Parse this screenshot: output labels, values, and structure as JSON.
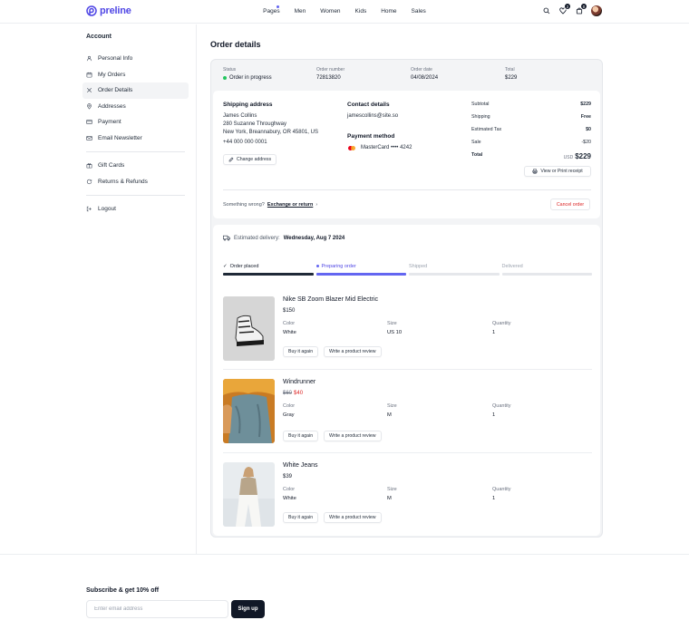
{
  "brand": {
    "name": "preline",
    "accent": "#4f46e5"
  },
  "nav": [
    "Pages",
    "Men",
    "Women",
    "Kids",
    "Home",
    "Sales"
  ],
  "header": {
    "wishlist_count": "2",
    "cart_count": "0"
  },
  "sidebar": {
    "title": "Account",
    "items": [
      {
        "label": "Personal Info",
        "icon": "user-icon"
      },
      {
        "label": "My Orders",
        "icon": "calendar-icon"
      },
      {
        "label": "Order Details",
        "icon": "order-icon"
      },
      {
        "label": "Addresses",
        "icon": "map-pin-icon"
      },
      {
        "label": "Payment",
        "icon": "credit-card-icon"
      },
      {
        "label": "Email Newsletter",
        "icon": "mail-icon"
      },
      {
        "label": "Gift Cards",
        "icon": "gift-icon"
      },
      {
        "label": "Returns & Refunds",
        "icon": "refresh-icon"
      },
      {
        "label": "Logout",
        "icon": "logout-icon"
      }
    ]
  },
  "page_title": "Order details",
  "summary": {
    "status_label": "Status",
    "status_value": "Order in progress",
    "number_label": "Order number",
    "number_value": "72813820",
    "date_label": "Order date",
    "date_value": "04/08/2024",
    "total_label": "Total",
    "total_value": "$229"
  },
  "shipping": {
    "title": "Shipping address",
    "name": "James Collins",
    "street": "280 Suzanne Throughway",
    "city": "New York, Breannabury, OR 45801, US",
    "phone": "+44 000 000 0001",
    "change_label": "Change address"
  },
  "contact": {
    "title": "Contact details",
    "email": "jamescollins@site.so"
  },
  "payment": {
    "title": "Payment method",
    "method": "MasterCard •••• 4242"
  },
  "totals": {
    "rows": [
      {
        "label": "Subtotal",
        "value": "$229"
      },
      {
        "label": "Shipping",
        "value": "Free"
      },
      {
        "label": "Estimated Tax",
        "value": "$0"
      },
      {
        "label": "Sale",
        "value": "-$20"
      }
    ],
    "total_label": "Total",
    "total_currency": "USD",
    "total_value": "$229",
    "receipt_label": "View or Print receipt"
  },
  "issue": {
    "text": "Something wrong?",
    "link": "Exchange or return",
    "chevron": "›",
    "cancel_label": "Cancel order"
  },
  "delivery": {
    "prefix": "Estimated delivery:",
    "date": "Wednesday, Aug 7 2024"
  },
  "steps": [
    {
      "label": "Order placed",
      "state": "done"
    },
    {
      "label": "Preparing order",
      "state": "active"
    },
    {
      "label": "Shipped",
      "state": "pending"
    },
    {
      "label": "Delivered",
      "state": "pending"
    }
  ],
  "attr_labels": {
    "color": "Color",
    "size": "Size",
    "quantity": "Quantity"
  },
  "actions": {
    "buy_again": "Buy it again",
    "review": "Write a product review"
  },
  "items": [
    {
      "name": "Nike SB Zoom Blazer Mid Electric",
      "price": "$150",
      "old_price": "",
      "color": "White",
      "size": "US 10",
      "quantity": "1"
    },
    {
      "name": "Windrunner",
      "price": "$40",
      "old_price": "$60",
      "color": "Gray",
      "size": "M",
      "quantity": "1"
    },
    {
      "name": "White Jeans",
      "price": "$39",
      "old_price": "",
      "color": "White",
      "size": "M",
      "quantity": "1"
    }
  ],
  "subscribe": {
    "title": "Subscribe & get 10% off",
    "placeholder": "Enter email address",
    "button": "Sign up"
  }
}
